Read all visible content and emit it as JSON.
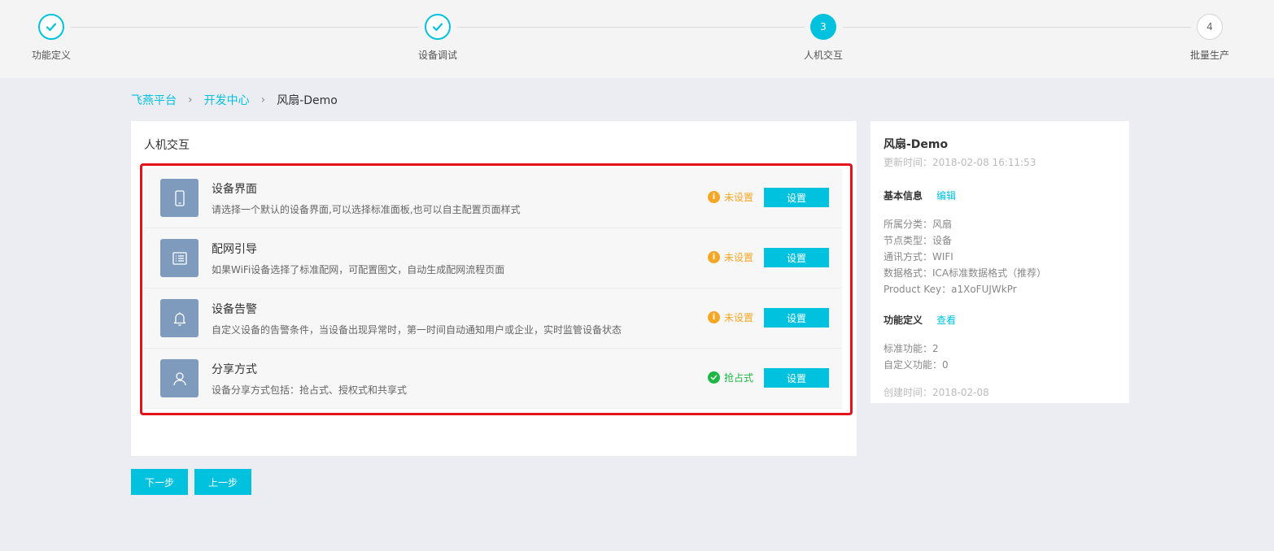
{
  "stepper": {
    "steps": [
      {
        "label": "功能定义",
        "state": "done",
        "num": ""
      },
      {
        "label": "设备调试",
        "state": "done",
        "num": ""
      },
      {
        "label": "人机交互",
        "state": "active",
        "num": "3"
      },
      {
        "label": "批量生产",
        "state": "todo",
        "num": "4"
      }
    ]
  },
  "breadcrumb": {
    "items": [
      "飞燕平台",
      "开发中心"
    ],
    "current": "风扇-Demo",
    "separator": "›"
  },
  "main": {
    "title": "人机交互",
    "rows": [
      {
        "icon": "phone-icon",
        "title": "设备界面",
        "desc": "请选择一个默认的设备界面,可以选择标准面板,也可以自主配置页面样式",
        "status": "未设置",
        "status_type": "warn",
        "button": "设置"
      },
      {
        "icon": "list-icon",
        "title": "配网引导",
        "desc": "如果WiFi设备选择了标准配网，可配置图文，自动生成配网流程页面",
        "status": "未设置",
        "status_type": "warn",
        "button": "设置"
      },
      {
        "icon": "bell-icon",
        "title": "设备告警",
        "desc": "自定义设备的告警条件，当设备出现异常时，第一时间自动通知用户或企业，实时监管设备状态",
        "status": "未设置",
        "status_type": "warn",
        "button": "设置"
      },
      {
        "icon": "user-icon",
        "title": "分享方式",
        "desc": "设备分享方式包括：抢占式、授权式和共享式",
        "status": "抢占式",
        "status_type": "ok",
        "button": "设置"
      }
    ]
  },
  "buttons": {
    "next": "下一步",
    "prev": "上一步"
  },
  "side": {
    "name": "风扇-Demo",
    "updated": "更新时间：2018-02-08 16:11:53",
    "basic_title": "基本信息",
    "basic_link": "编辑",
    "basic_info": [
      "所属分类：风扇",
      "节点类型：设备",
      "通讯方式：WIFI",
      "数据格式：ICA标准数据格式（推荐）",
      "Product Key：a1XoFUJWkPr"
    ],
    "func_title": "功能定义",
    "func_link": "查看",
    "func_info": [
      "标准功能：2",
      "自定义功能：0"
    ],
    "created": "创建时间：2018-02-08"
  },
  "colors": {
    "accent": "#00c1de",
    "warn": "#f5a623",
    "ok": "#1eb744",
    "highlight": "#e3131b"
  }
}
